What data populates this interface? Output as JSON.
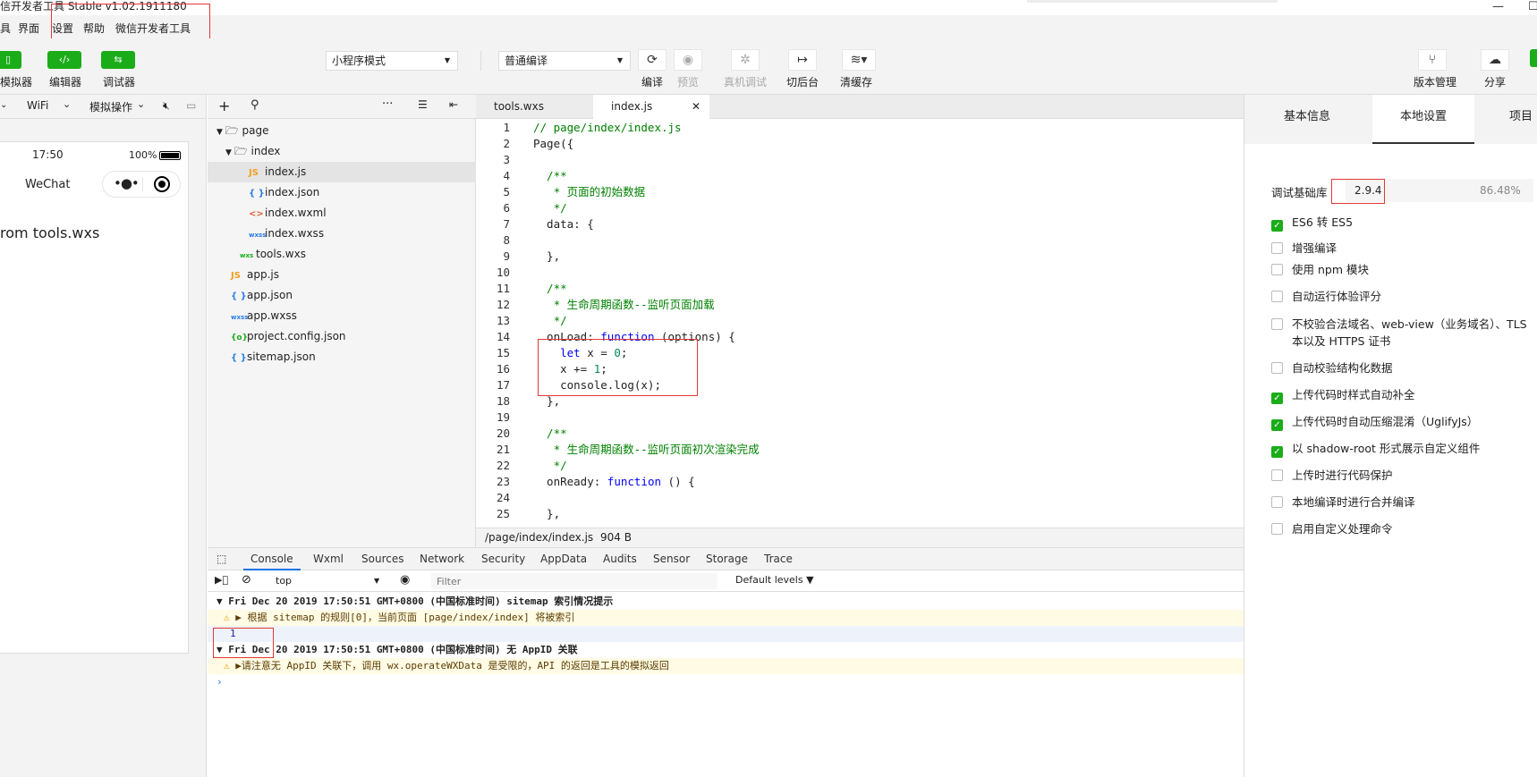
{
  "window": {
    "title": "信开发者工具 Stable v1.02.1911180",
    "minimize": "—",
    "maximize": "☐"
  },
  "menubar": [
    "具",
    "界面",
    "设置",
    "帮助",
    "微信开发者工具"
  ],
  "toolbar": {
    "simulator": "模拟器",
    "editor": "编辑器",
    "debugger": "调试器",
    "mode": "小程序模式",
    "compile_mode": "普通编译",
    "compile": "编译",
    "preview": "预览",
    "remote_debug": "真机调试",
    "background": "切后台",
    "clear_cache": "清缓存",
    "version": "版本管理",
    "share": "分享"
  },
  "simulator": {
    "network": "WiFi",
    "sim_ops": "模拟操作",
    "time": "17:50",
    "battery": "100%",
    "app_name": "WeChat",
    "content": "rom tools.wxs"
  },
  "filetree": [
    {
      "label": "page",
      "icon": "folder",
      "depth": 0,
      "open": true
    },
    {
      "label": "index",
      "icon": "folder",
      "depth": 1,
      "open": true
    },
    {
      "label": "index.js",
      "icon": "js",
      "depth": 2,
      "selected": true
    },
    {
      "label": "index.json",
      "icon": "json",
      "depth": 2
    },
    {
      "label": "index.wxml",
      "icon": "wxml",
      "depth": 2
    },
    {
      "label": "index.wxss",
      "icon": "wxss",
      "depth": 2
    },
    {
      "label": "tools.wxs",
      "icon": "wxs",
      "depth": 1
    },
    {
      "label": "app.js",
      "icon": "js",
      "depth": 0
    },
    {
      "label": "app.json",
      "icon": "json",
      "depth": 0
    },
    {
      "label": "app.wxss",
      "icon": "wxss",
      "depth": 0
    },
    {
      "label": "project.config.json",
      "icon": "config",
      "depth": 0
    },
    {
      "label": "sitemap.json",
      "icon": "json",
      "depth": 0
    }
  ],
  "editor": {
    "tabs": [
      {
        "label": "tools.wxs"
      },
      {
        "label": "index.js",
        "close": "✕"
      }
    ],
    "lines": [
      {
        "n": "1",
        "code": "// page/index/index.js"
      },
      {
        "n": "2",
        "code": "Page({"
      },
      {
        "n": "3",
        "code": ""
      },
      {
        "n": "4",
        "code": "  /**"
      },
      {
        "n": "5",
        "code": "   * 页面的初始数据"
      },
      {
        "n": "6",
        "code": "   */"
      },
      {
        "n": "7",
        "code": "  data: {"
      },
      {
        "n": "8",
        "code": ""
      },
      {
        "n": "9",
        "code": "  },"
      },
      {
        "n": "10",
        "code": ""
      },
      {
        "n": "11",
        "code": "  /**"
      },
      {
        "n": "12",
        "code": "   * 生命周期函数--监听页面加载"
      },
      {
        "n": "13",
        "code": "   */"
      },
      {
        "n": "14",
        "code": "  onLoad: function (options) {"
      },
      {
        "n": "15",
        "code": "    let x = 0;"
      },
      {
        "n": "16",
        "code": "    x += 1;"
      },
      {
        "n": "17",
        "code": "    console.log(x);"
      },
      {
        "n": "18",
        "code": "  },"
      },
      {
        "n": "19",
        "code": ""
      },
      {
        "n": "20",
        "code": "  /**"
      },
      {
        "n": "21",
        "code": "   * 生命周期函数--监听页面初次渲染完成"
      },
      {
        "n": "22",
        "code": "   */"
      },
      {
        "n": "23",
        "code": "  onReady: function () {"
      },
      {
        "n": "24",
        "code": ""
      },
      {
        "n": "25",
        "code": "  },"
      }
    ],
    "path": "/page/index/index.js",
    "size": "904 B"
  },
  "devtools": {
    "tabs": [
      "Console",
      "Wxml",
      "Sources",
      "Network",
      "Security",
      "AppData",
      "Audits",
      "Sensor",
      "Storage",
      "Trace"
    ],
    "context": "top",
    "filter_placeholder": "Filter",
    "levels": "Default levels ▼",
    "logs": {
      "group1": "Fri Dec 20 2019 17:50:51 GMT+0800 (中国标准时间) sitemap 索引情况提示",
      "warn1": "根据 sitemap 的规则[0]，当前页面 [page/index/index] 将被索引",
      "output": "1",
      "group2": "Fri Dec 20 2019 17:50:51 GMT+0800 (中国标准时间) 无 AppID 关联",
      "warn2": "请注意无 AppID 关联下，调用 wx.operateWXData 是受限的，API 的返回是工具的模拟返回"
    }
  },
  "rightpanel": {
    "tabs": [
      "基本信息",
      "本地设置",
      "项目"
    ],
    "lib_label": "调试基础库",
    "lib_version": "2.9.4",
    "lib_percent": "86.48%",
    "options": [
      {
        "label": "ES6 转 ES5",
        "checked": true
      },
      {
        "label": "增强编译",
        "checked": false
      },
      {
        "label": "使用 npm 模块",
        "checked": false
      },
      {
        "label": "自动运行体验评分",
        "checked": false
      },
      {
        "label": "不校验合法域名、web-view（业务域名）、TLS",
        "label2": "本以及 HTTPS 证书",
        "checked": false
      },
      {
        "label": "自动校验结构化数据",
        "checked": false
      },
      {
        "label": "上传代码时样式自动补全",
        "checked": true
      },
      {
        "label": "上传代码时自动压缩混淆（UglifyJs）",
        "checked": true
      },
      {
        "label": "以 shadow-root 形式展示自定义组件",
        "checked": true
      },
      {
        "label": "上传时进行代码保护",
        "checked": false
      },
      {
        "label": "本地编译时进行合并编译",
        "checked": false
      },
      {
        "label": "启用自定义处理命令",
        "checked": false
      }
    ]
  },
  "colors": {
    "accent": "#1aad19",
    "highlight": "#e53935",
    "keyword": "#0000ff",
    "comment": "#008000"
  }
}
